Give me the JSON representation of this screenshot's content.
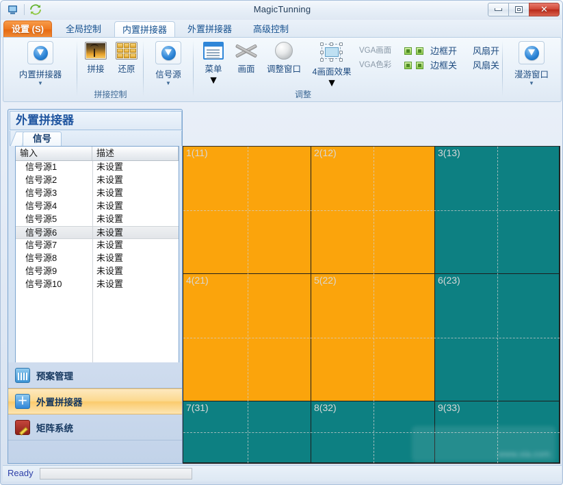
{
  "window": {
    "title": "MagicTunning",
    "quick_access": [
      "app-icon",
      "refresh-icon"
    ],
    "controls": {
      "minimize": "minimize-icon",
      "maximize": "maximize-icon",
      "close": "✕"
    }
  },
  "tabs": [
    {
      "label": "设置 (S)",
      "kind": "file"
    },
    {
      "label": "全局控制",
      "kind": "normal"
    },
    {
      "label": "内置拼接器",
      "kind": "active"
    },
    {
      "label": "外置拼接器",
      "kind": "normal"
    },
    {
      "label": "高级控制",
      "kind": "normal"
    }
  ],
  "ribbon": {
    "groups": [
      {
        "label": "",
        "buttons": [
          {
            "label": "内置拼接器",
            "icon": "blue-download-icon",
            "has_menu": true
          }
        ]
      },
      {
        "label": "拼接控制",
        "buttons": [
          {
            "label": "拼接",
            "icon": "splice-image-icon"
          },
          {
            "label": "还原",
            "icon": "restore-grid-icon"
          }
        ]
      },
      {
        "label": "",
        "buttons": [
          {
            "label": "信号源",
            "icon": "blue-download-icon",
            "has_menu": true
          }
        ]
      },
      {
        "label": "调整",
        "buttons": [
          {
            "label": "菜单",
            "icon": "menu-list-icon",
            "has_menu": true
          },
          {
            "label": "画面",
            "icon": "picture-cross-icon"
          },
          {
            "label": "调整窗口",
            "icon": "sphere-icon"
          },
          {
            "label": "4画面效果",
            "icon": "four-screen-icon",
            "has_menu": true
          }
        ],
        "small_items": [
          {
            "label": "VGA画面",
            "dim": true
          },
          {
            "label": "VGA色彩",
            "dim": true
          },
          {
            "label": "边框开"
          },
          {
            "label": "边框关"
          },
          {
            "label": "风扇开"
          },
          {
            "label": "风扇关"
          }
        ]
      },
      {
        "label": "",
        "buttons": [
          {
            "label": "漫游窗口",
            "icon": "blue-download-icon",
            "has_menu": true
          }
        ]
      }
    ]
  },
  "left_panel": {
    "title": "外置拼接器",
    "tab": "信号",
    "table": {
      "columns": [
        "输入",
        "描述"
      ],
      "selected_index": 5,
      "rows": [
        {
          "input": "信号源1",
          "desc": "未设置"
        },
        {
          "input": "信号源2",
          "desc": "未设置"
        },
        {
          "input": "信号源3",
          "desc": "未设置"
        },
        {
          "input": "信号源4",
          "desc": "未设置"
        },
        {
          "input": "信号源5",
          "desc": "未设置"
        },
        {
          "input": "信号源6",
          "desc": "未设置"
        },
        {
          "input": "信号源7",
          "desc": "未设置"
        },
        {
          "input": "信号源8",
          "desc": "未设置"
        },
        {
          "input": "信号源9",
          "desc": "未设置"
        },
        {
          "input": "信号源10",
          "desc": "未设置"
        }
      ]
    },
    "scrollbar": {
      "left_arrow": "◀",
      "right_arrow": "▶",
      "thumb": "||||"
    }
  },
  "left_nav": {
    "items": [
      {
        "label": "预案管理",
        "icon": "preset-calendar-icon",
        "active": false
      },
      {
        "label": "外置拼接器",
        "icon": "splicer-plus-icon",
        "active": true
      },
      {
        "label": "矩阵系统",
        "icon": "matrix-book-icon",
        "active": false
      }
    ]
  },
  "wall": {
    "colors": {
      "orange": "#FBA40C",
      "teal": "#0D8082",
      "border": "#1c1c1c",
      "dash": "#cfcfcf"
    },
    "cells": [
      {
        "name": "1(11)",
        "color": "orange",
        "col": 0,
        "row": 0
      },
      {
        "name": "2(12)",
        "color": "orange",
        "col": 1,
        "row": 0
      },
      {
        "name": "3(13)",
        "color": "teal",
        "col": 2,
        "row": 0
      },
      {
        "name": "4(21)",
        "color": "orange",
        "col": 0,
        "row": 1
      },
      {
        "name": "5(22)",
        "color": "orange",
        "col": 1,
        "row": 1
      },
      {
        "name": "6(23)",
        "color": "teal",
        "col": 2,
        "row": 1
      },
      {
        "name": "7(31)",
        "color": "teal",
        "col": 0,
        "row": 2
      },
      {
        "name": "8(32)",
        "color": "teal",
        "col": 1,
        "row": 2
      },
      {
        "name": "9(33)",
        "color": "teal",
        "col": 2,
        "row": 2
      }
    ],
    "watermark": "www.xia.com"
  },
  "status": {
    "text": "Ready",
    "progress_value": ""
  }
}
